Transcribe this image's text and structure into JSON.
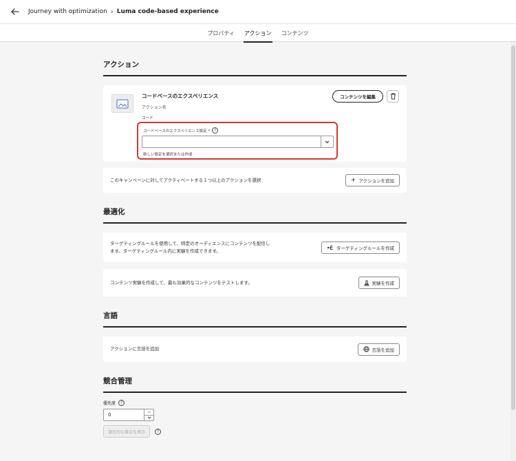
{
  "header": {
    "breadcrumb_parent": "Journey with optimization",
    "breadcrumb_current": "Luma code-based experience"
  },
  "tabs": [
    {
      "label": "プロパティ"
    },
    {
      "label": "アクション"
    },
    {
      "label": "コンテンツ"
    }
  ],
  "sections": {
    "action": {
      "title": "アクション",
      "card": {
        "name": "コードベースのエクスペリエンス",
        "subtitle": "アクション名",
        "code_label": "コード",
        "edit_button": "コンテンツを編集",
        "field_label": "コードベースのエクスペリエンス設定 *",
        "field_value": "",
        "field_help": "新しい設定を選択または作成"
      },
      "add_row_text": "このキャンペーンに対してアクティベートする１つ以上のアクションを選択",
      "add_button": "アクションを追加"
    },
    "optimization": {
      "title": "最適化",
      "targeting_text_1": "ターゲティングルールを使用して、特定のオーディエンスにコンテンツを配信し",
      "targeting_text_2": "ます。ターゲティングルール内に実験を作成できます。",
      "targeting_button": "ターゲティングルールを作成",
      "experiment_text": "コンテンツ実験を作成して、最も効果的なコンテンツをテストします。",
      "experiment_button": "実験を作成"
    },
    "language": {
      "title": "言語",
      "text": "アクションに言語を追加",
      "button": "言語を追加"
    },
    "conflict": {
      "title": "競合管理",
      "priority_label": "優先度",
      "priority_value": "0",
      "view_conflicts_button": "潜在的な競合を表示"
    }
  },
  "colors": {
    "highlight": "#d9342b"
  }
}
